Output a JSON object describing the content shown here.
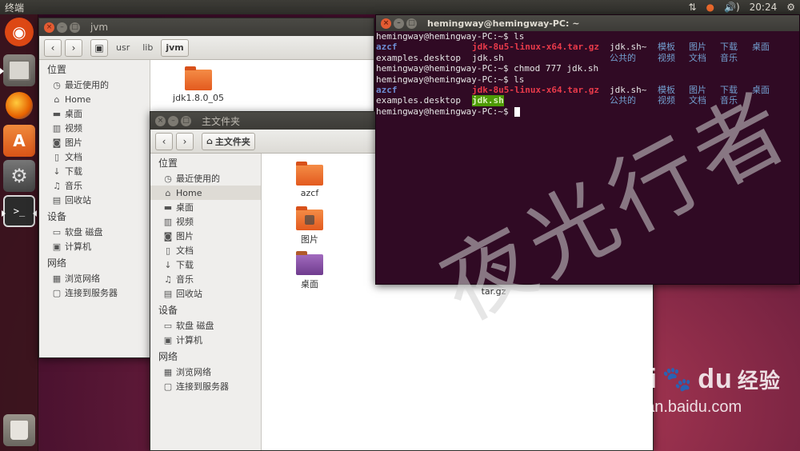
{
  "top_panel": {
    "app_title": "终端",
    "indicators": {
      "network": "⇅",
      "volume": "🔊)",
      "clock": "20:24",
      "settings": "⚙"
    }
  },
  "launcher": {
    "items": [
      {
        "name": "dash",
        "glyph": "◉"
      },
      {
        "name": "files",
        "glyph": "▤"
      },
      {
        "name": "firefox",
        "glyph": "🦊"
      },
      {
        "name": "software-center",
        "glyph": "A"
      },
      {
        "name": "system-settings",
        "glyph": "⚙"
      },
      {
        "name": "terminal",
        "glyph": ">_"
      },
      {
        "name": "trash",
        "glyph": "🗑"
      }
    ]
  },
  "jvm_window": {
    "title": "jvm",
    "breadcrumbs": [
      "usr",
      "lib",
      "jvm"
    ],
    "sidebar": {
      "places_header": "位置",
      "places": [
        "最近使用的",
        "Home",
        "桌面",
        "视频",
        "图片",
        "文档",
        "下载",
        "音乐",
        "回收站"
      ],
      "devices_header": "设备",
      "devices": [
        "软盘 磁盘",
        "计算机"
      ],
      "network_header": "网络",
      "network": [
        "浏览网络",
        "连接到服务器"
      ]
    },
    "files": [
      {
        "name": "jdk1.8.0_05"
      }
    ]
  },
  "home_window": {
    "title": "主文件夹",
    "breadcrumb": "主文件夹",
    "sidebar": {
      "places_header": "位置",
      "places": [
        "最近使用的",
        "Home",
        "桌面",
        "视频",
        "图片",
        "文档",
        "下载",
        "音乐",
        "回收站"
      ],
      "devices_header": "设备",
      "devices": [
        "软盘 磁盘",
        "计算机"
      ],
      "network_header": "网络",
      "network": [
        "浏览网络",
        "连接到服务器"
      ]
    },
    "files": [
      {
        "name": "azcf"
      },
      {
        "name": "图片"
      },
      {
        "name": "桌面"
      }
    ],
    "partial_label": "tar.gz"
  },
  "terminal": {
    "title": "hemingway@hemingway-PC: ~",
    "lines": [
      {
        "prompt": "hemingway@hemingway-PC:~$ ",
        "cmd": "ls"
      },
      {
        "cols": [
          {
            "text": "azcf",
            "style": "c-blue",
            "col": 0
          },
          {
            "text": "jdk-8u5-linux-x64.tar.gz",
            "style": "c-red",
            "col": 1
          },
          {
            "text": "jdk.sh~",
            "style": "",
            "col": 2
          },
          {
            "text": "模板",
            "style": "c-sky",
            "col": 3
          },
          {
            "text": "图片",
            "style": "c-sky",
            "col": 4
          },
          {
            "text": "下载",
            "style": "c-sky",
            "col": 5
          },
          {
            "text": "桌面",
            "style": "c-sky",
            "col": 6
          }
        ]
      },
      {
        "cols": [
          {
            "text": "examples.desktop",
            "style": "",
            "col": 0
          },
          {
            "text": "jdk.sh",
            "style": "",
            "col": 7
          },
          {
            "text": "公共的",
            "style": "c-sky",
            "col": 2
          },
          {
            "text": "视频",
            "style": "c-sky",
            "col": 3
          },
          {
            "text": "文档",
            "style": "c-sky",
            "col": 4
          },
          {
            "text": "音乐",
            "style": "c-sky",
            "col": 5
          }
        ]
      },
      {
        "prompt": "hemingway@hemingway-PC:~$ ",
        "cmd": "chmod 777 jdk.sh"
      },
      {
        "prompt": "hemingway@hemingway-PC:~$ ",
        "cmd": "ls"
      },
      {
        "cols": [
          {
            "text": "azcf",
            "style": "c-blue",
            "col": 0
          },
          {
            "text": "jdk-8u5-linux-x64.tar.gz",
            "style": "c-red",
            "col": 1
          },
          {
            "text": "jdk.sh~",
            "style": "",
            "col": 2
          },
          {
            "text": "模板",
            "style": "c-sky",
            "col": 3
          },
          {
            "text": "图片",
            "style": "c-sky",
            "col": 4
          },
          {
            "text": "下载",
            "style": "c-sky",
            "col": 5
          },
          {
            "text": "桌面",
            "style": "c-sky",
            "col": 6
          }
        ]
      },
      {
        "cols": [
          {
            "text": "examples.desktop",
            "style": "",
            "col": 0
          },
          {
            "text": "jdk.sh",
            "style": "c-hl",
            "col": 7
          },
          {
            "text": "公共的",
            "style": "c-sky",
            "col": 2
          },
          {
            "text": "视频",
            "style": "c-sky",
            "col": 3
          },
          {
            "text": "文档",
            "style": "c-sky",
            "col": 4
          },
          {
            "text": "音乐",
            "style": "c-sky",
            "col": 5
          }
        ]
      },
      {
        "prompt": "hemingway@hemingway-PC:~$ ",
        "cmd": "",
        "cursor": true
      }
    ]
  },
  "watermark": {
    "text": "夜光行者",
    "brand": "Bai",
    "brand_suffix": "du",
    "brand_cn": "经验",
    "url": "jingyan.baidu.com"
  }
}
